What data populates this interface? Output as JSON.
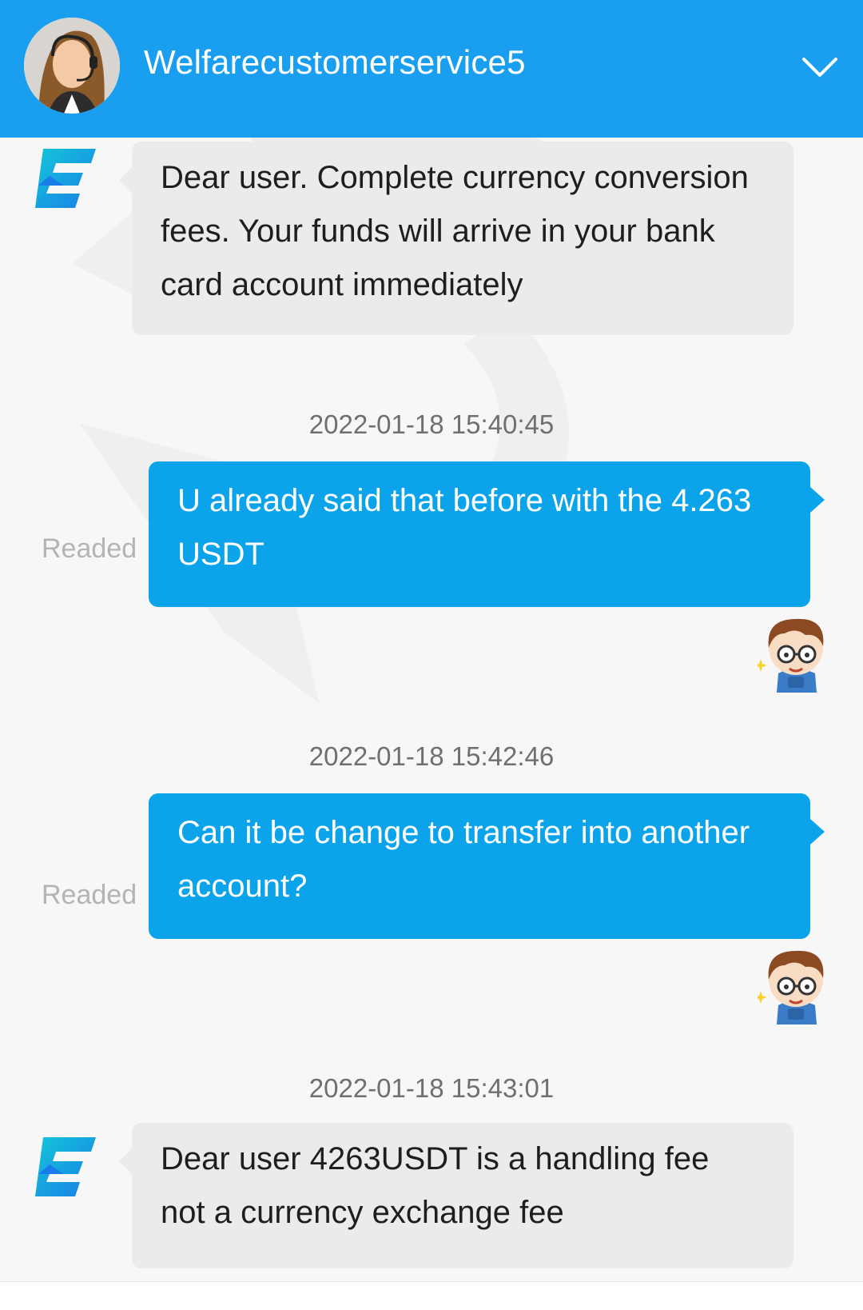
{
  "header": {
    "agent_name": "Welfarecustomerservice5",
    "dropdown_icon": "chevron-down-icon",
    "background_color": "#1a9ff0"
  },
  "colors": {
    "incoming_bubble": "#eaebeb",
    "outgoing_bubble": "#0ba4ea",
    "timestamp_text": "#6f6f6f",
    "read_status_text": "#b4b4b4"
  },
  "messages": [
    {
      "direction": "incoming",
      "avatar_icon": "exchange-logo-icon",
      "lines": [
        "Dear user. Complete currency conversion",
        "fees. Your funds will arrive in your bank",
        "card account immediately"
      ]
    },
    {
      "direction": "outgoing",
      "timestamp": "2022-01-18 15:40:45",
      "status": "Readed",
      "avatar_icon": "cartoon-boy-avatar",
      "lines": [
        "U already said that before with the 4.263",
        "USDT"
      ]
    },
    {
      "direction": "outgoing",
      "timestamp": "2022-01-18 15:42:46",
      "status": "Readed",
      "avatar_icon": "cartoon-boy-avatar",
      "lines": [
        "Can it be change to transfer into another",
        "account?"
      ]
    },
    {
      "direction": "incoming",
      "timestamp": "2022-01-18 15:43:01",
      "avatar_icon": "exchange-logo-icon",
      "lines": [
        "Dear user 4263USDT is a handling fee",
        "not a currency exchange fee"
      ]
    }
  ]
}
